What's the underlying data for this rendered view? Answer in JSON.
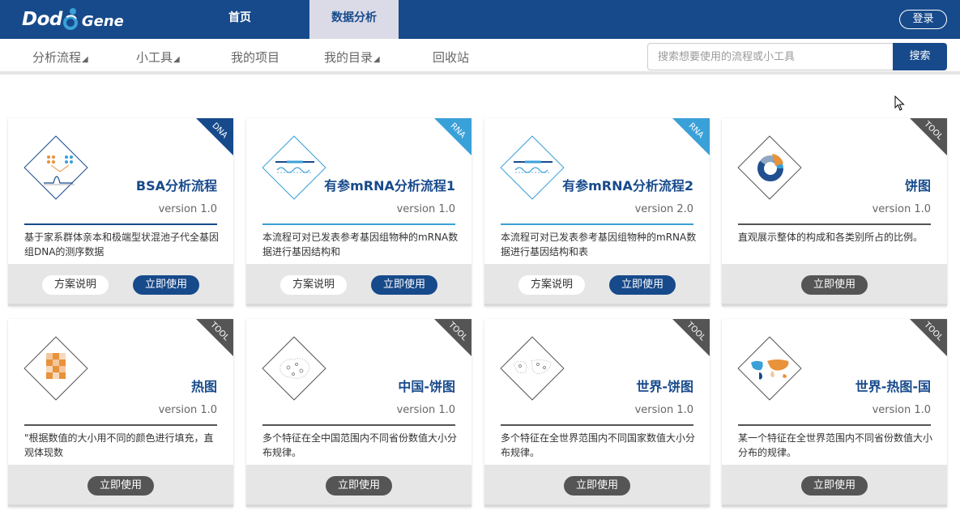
{
  "header": {
    "logo_text_1": "Dod",
    "logo_text_2": "Gene",
    "nav": [
      "首页",
      "数据分析"
    ],
    "login": "登录"
  },
  "subnav": {
    "items": [
      {
        "label": "分析流程",
        "dropdown": true
      },
      {
        "label": "小工具",
        "dropdown": true
      },
      {
        "label": "我的项目",
        "dropdown": false
      },
      {
        "label": "我的目录",
        "dropdown": true
      },
      {
        "label": "回收站",
        "dropdown": false
      }
    ],
    "dropdown_glyph": "◢",
    "search_placeholder": "搜索想要使用的流程或小工具",
    "search_button": "搜索"
  },
  "colors": {
    "brand": "#174a8b",
    "rna": "#3aa0d8",
    "tool": "#555555",
    "dna": "#174a8b"
  },
  "cards": [
    {
      "tag": "DNA",
      "title": "BSA分析流程",
      "version": "version 1.0",
      "desc": "基于家系群体亲本和极端型状混池子代全基因组DNA的测序数据",
      "buttons": [
        "方案说明",
        "立即使用"
      ],
      "icon": "bsa-chart-icon"
    },
    {
      "tag": "RNA",
      "title": "有参mRNA分析流程1",
      "version": "version 1.0",
      "desc": "本流程可对已发表参考基因组物种的mRNA数据进行基因结构和",
      "buttons": [
        "方案说明",
        "立即使用"
      ],
      "icon": "rna-strand-icon"
    },
    {
      "tag": "RNA",
      "title": "有参mRNA分析流程2",
      "version": "version 2.0",
      "desc": "本流程可对已发表参考基因组物种的mRNA数据进行基因结构和表",
      "buttons": [
        "方案说明",
        "立即使用"
      ],
      "icon": "rna-strand-icon"
    },
    {
      "tag": "TOOL",
      "title": "饼图",
      "version": "version 1.0",
      "desc": "直观展示整体的构成和各类别所占的比例。",
      "buttons": [
        "立即使用"
      ],
      "icon": "pie-chart-icon"
    },
    {
      "tag": "TOOL",
      "title": "热图",
      "version": "version 1.0",
      "desc": "\"根据数值的大小用不同的颜色进行填充，直观体现数",
      "buttons": [
        "立即使用"
      ],
      "icon": "heatmap-icon"
    },
    {
      "tag": "TOOL",
      "title": "中国-饼图",
      "version": "version 1.0",
      "desc": "多个特征在全中国范围内不同省份数值大小分布规律。",
      "buttons": [
        "立即使用"
      ],
      "icon": "china-map-icon"
    },
    {
      "tag": "TOOL",
      "title": "世界-饼图",
      "version": "version 1.0",
      "desc": "多个特征在全世界范围内不同国家数值大小分布规律。",
      "buttons": [
        "立即使用"
      ],
      "icon": "world-map-icon"
    },
    {
      "tag": "TOOL",
      "title": "世界-热图-国",
      "version": "version 1.0",
      "desc": "某一个特征在全世界范围内不同省份数值大小分布的规律。",
      "buttons": [
        "立即使用"
      ],
      "icon": "world-heatmap-icon"
    }
  ]
}
